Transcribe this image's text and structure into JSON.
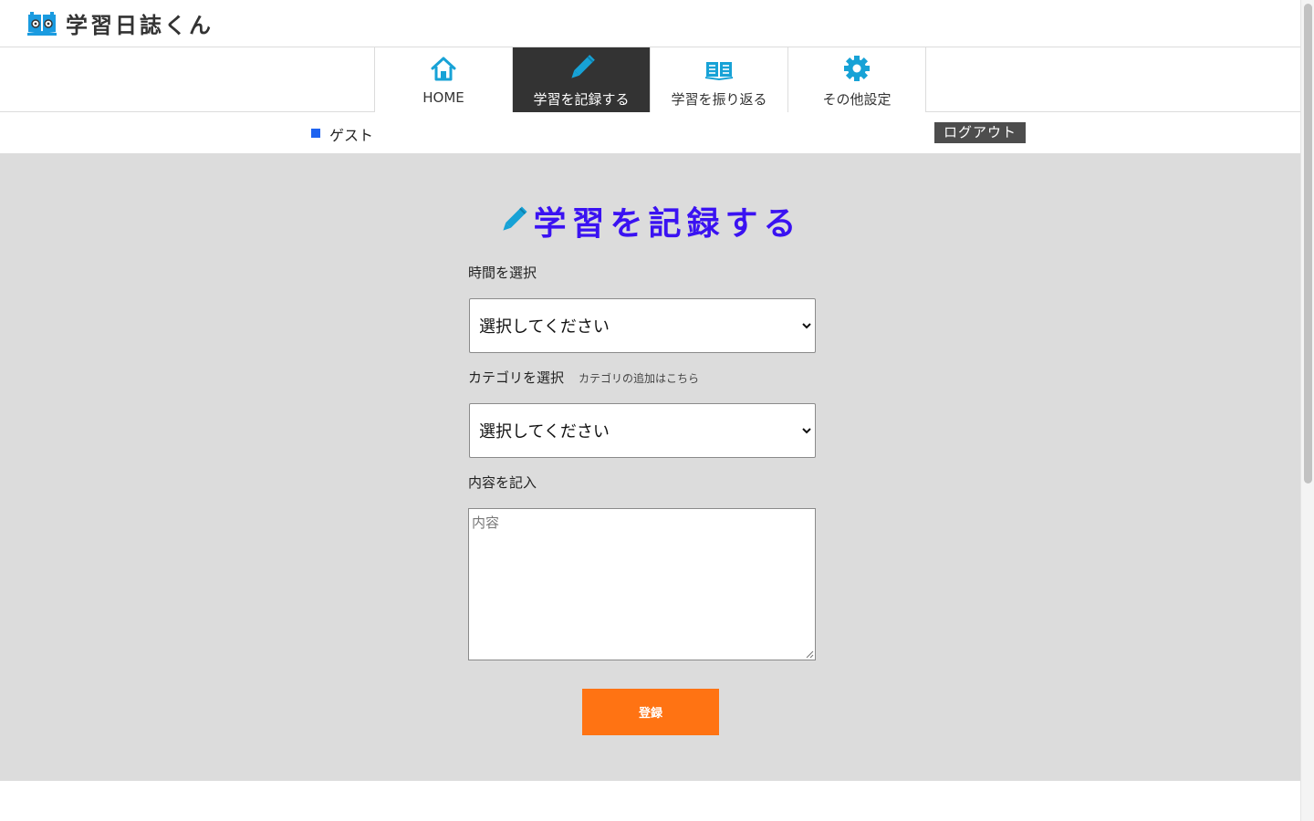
{
  "header": {
    "site_title": "学習日誌くん",
    "logo_icon": "book-glasses-icon"
  },
  "nav": {
    "items": [
      {
        "label": "HOME",
        "icon": "home-icon",
        "active": false
      },
      {
        "label": "学習を記録する",
        "icon": "pencil-icon",
        "active": true
      },
      {
        "label": "学習を振り返る",
        "icon": "open-book-icon",
        "active": false
      },
      {
        "label": "その他設定",
        "icon": "gear-icon",
        "active": false
      }
    ]
  },
  "userbar": {
    "user_name": "ゲスト",
    "logout_label": "ログアウト"
  },
  "main": {
    "title": "学習を記録する",
    "time_label": "時間を選択",
    "time_select_value": "選択してください",
    "category_label": "カテゴリを選択",
    "category_add_link": "カテゴリの追加はこちら",
    "category_select_value": "選択してください",
    "content_label": "内容を記入",
    "content_placeholder": "内容",
    "submit_label": "登録"
  },
  "colors": {
    "accent_blue": "#3a12f2",
    "icon_cyan": "#17a2d6",
    "submit_orange": "#ff7313",
    "main_bg": "#dcdcdc",
    "active_nav_bg": "#333333",
    "user_mark": "#1e63f0"
  }
}
